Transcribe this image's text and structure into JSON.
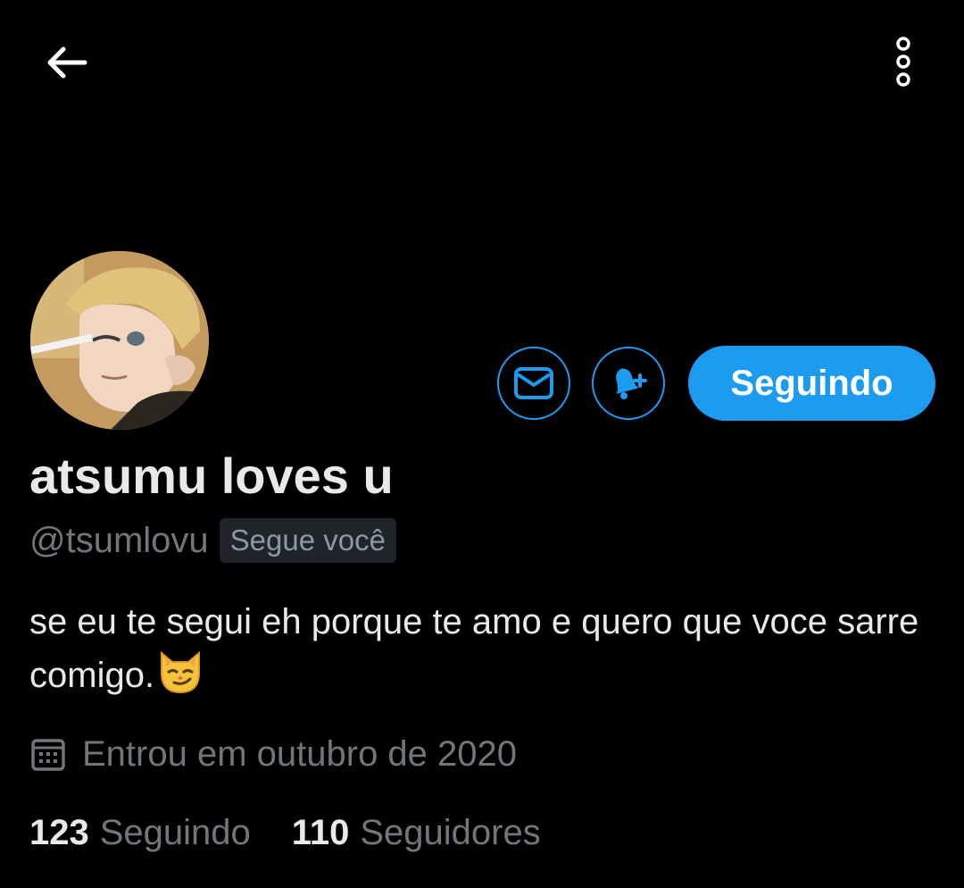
{
  "header": {
    "back_icon": "arrow-left-icon",
    "more_icon": "more-vertical-icon"
  },
  "profile": {
    "display_name": "atsumu loves u",
    "handle": "@tsumlovu",
    "follows_you_label": "Segue você",
    "bio": "se eu te segui eh porque te amo e quero que voce sarre comigo.",
    "bio_emoji": "smirking-cat-emoji",
    "joined": "Entrou em outubro de 2020",
    "joined_icon": "calendar-icon"
  },
  "actions": {
    "message_icon": "envelope-icon",
    "notify_icon": "bell-plus-icon",
    "follow_label": "Seguindo"
  },
  "stats": {
    "following_count": "123",
    "following_label": "Seguindo",
    "followers_count": "110",
    "followers_label": "Seguidores"
  },
  "colors": {
    "background": "#000000",
    "accent": "#1d9bf0",
    "text_primary": "#e7e9ea",
    "text_secondary": "#71767b",
    "badge_bg": "#202327"
  }
}
